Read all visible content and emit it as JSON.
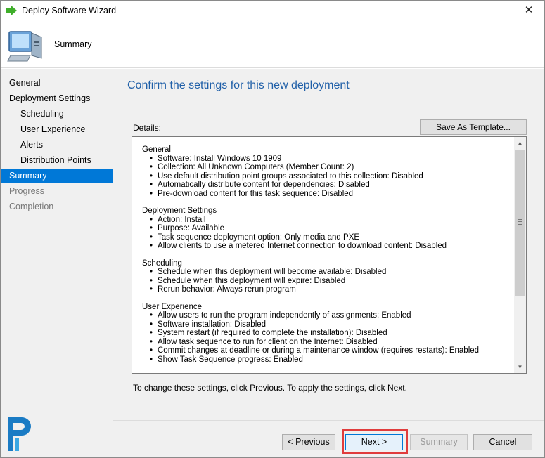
{
  "window": {
    "title": "Deploy Software Wizard",
    "close_glyph": "✕"
  },
  "header": {
    "title": "Summary",
    "icon": "computer-icon"
  },
  "nav": {
    "items": [
      {
        "label": "General",
        "level": "top",
        "state": "normal"
      },
      {
        "label": "Deployment Settings",
        "level": "top",
        "state": "normal"
      },
      {
        "label": "Scheduling",
        "level": "sub",
        "state": "normal"
      },
      {
        "label": "User Experience",
        "level": "sub",
        "state": "normal"
      },
      {
        "label": "Alerts",
        "level": "sub",
        "state": "normal"
      },
      {
        "label": "Distribution Points",
        "level": "sub",
        "state": "normal"
      },
      {
        "label": "Summary",
        "level": "top",
        "state": "active"
      },
      {
        "label": "Progress",
        "level": "top",
        "state": "disabled"
      },
      {
        "label": "Completion",
        "level": "top",
        "state": "disabled"
      }
    ]
  },
  "main": {
    "heading": "Confirm the settings for this new deployment",
    "details_label": "Details:",
    "save_template_label": "Save As Template...",
    "help_text": "To change these settings, click Previous. To apply the settings, click Next."
  },
  "details": {
    "sections": [
      {
        "title": "General",
        "items": [
          "Software: Install Windows 10 1909",
          "Collection: All Unknown Computers (Member Count: 2)",
          "Use default distribution point groups associated to this collection: Disabled",
          "Automatically distribute content for dependencies: Disabled",
          "Pre-download content for this task sequence: Disabled"
        ]
      },
      {
        "title": "Deployment Settings",
        "items": [
          "Action: Install",
          "Purpose: Available",
          "Task sequence deployment option: Only media and PXE",
          "Allow clients to use a metered Internet connection to download content: Disabled"
        ]
      },
      {
        "title": "Scheduling",
        "items": [
          "Schedule when this deployment will become available: Disabled",
          "Schedule when this deployment will expire: Disabled",
          "Rerun behavior: Always rerun program"
        ]
      },
      {
        "title": "User Experience",
        "items": [
          "Allow users to run the program independently of assignments: Enabled",
          "Software installation: Disabled",
          "System restart (if required to complete the installation): Disabled",
          "Allow task sequence to run for client on the Internet: Disabled",
          "Commit changes at deadline or during a maintenance window (requires restarts): Enabled",
          "Show Task Sequence progress: Enabled"
        ]
      }
    ]
  },
  "buttons": {
    "previous": "< Previous",
    "next": "Next >",
    "summary": "Summary",
    "cancel": "Cancel"
  },
  "colors": {
    "accent": "#0078d7",
    "heading": "#1f5fa8",
    "highlight": "#e03c3c"
  }
}
